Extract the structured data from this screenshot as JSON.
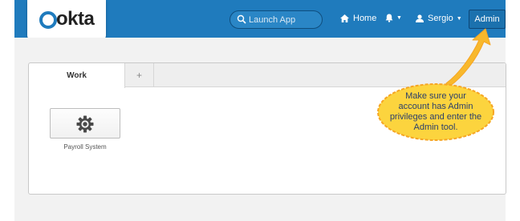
{
  "header": {
    "logo_text": "okta",
    "search": {
      "placeholder": "Launch App"
    },
    "nav": {
      "home_label": "Home",
      "user_label": "Sergio",
      "admin_label": "Admin"
    }
  },
  "tabs": [
    {
      "label": "Work"
    },
    {
      "label": "+"
    }
  ],
  "apps": [
    {
      "label": "Payroll System",
      "icon": "gear-icon"
    }
  ],
  "callout": {
    "lines": [
      "Make sure your",
      "account has Admin",
      "privileges and enter the",
      "Admin tool."
    ]
  },
  "colors": {
    "header_bg": "#1f7bbd",
    "callout_fill": "#fcd43e",
    "callout_stroke": "#f6a523",
    "page_bg": "#f2f2f2"
  }
}
